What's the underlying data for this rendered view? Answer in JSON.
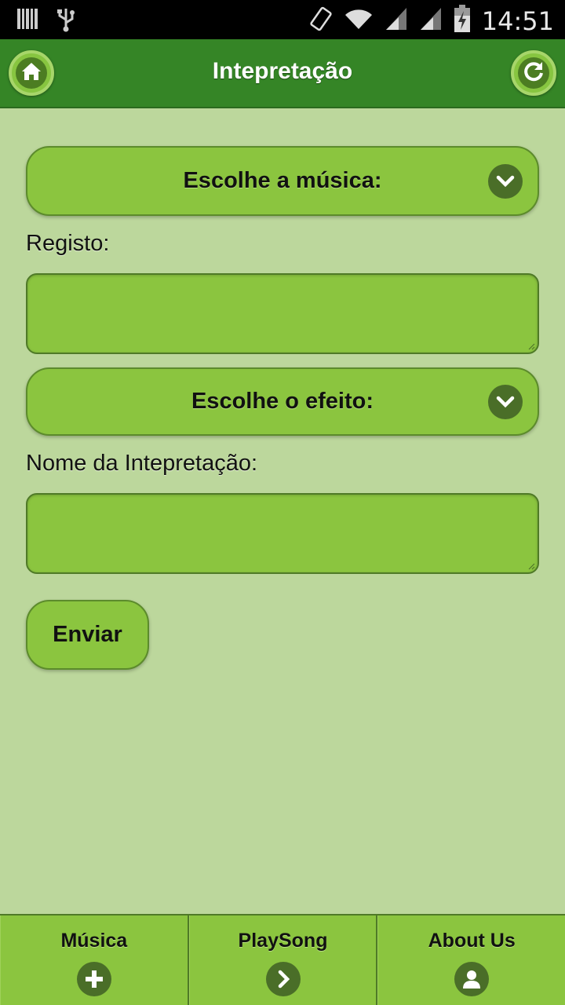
{
  "status_bar": {
    "time": "14:51",
    "icons": [
      "barcode-icon",
      "usb-icon",
      "vibrate-icon",
      "wifi-icon",
      "signal-icon",
      "signal-icon",
      "battery-charging-icon"
    ]
  },
  "header": {
    "title": "Intepretação",
    "left_icon": "home-icon",
    "right_icon": "refresh-icon"
  },
  "form": {
    "music_select_label": "Escolhe a música:",
    "registo_label": "Registo:",
    "registo_value": "",
    "effect_select_label": "Escolhe o efeito:",
    "name_label": "Nome da Intepretação:",
    "name_value": "",
    "submit_label": "Enviar"
  },
  "footer_nav": [
    {
      "label": "Música",
      "icon": "plus-icon"
    },
    {
      "label": "PlaySong",
      "icon": "chevron-right-icon"
    },
    {
      "label": "About Us",
      "icon": "user-icon"
    }
  ],
  "colors": {
    "header_bg": "#358526",
    "page_bg": "#bcd79c",
    "control_bg": "#8bc53f",
    "icon_bg": "#4a6e28"
  }
}
